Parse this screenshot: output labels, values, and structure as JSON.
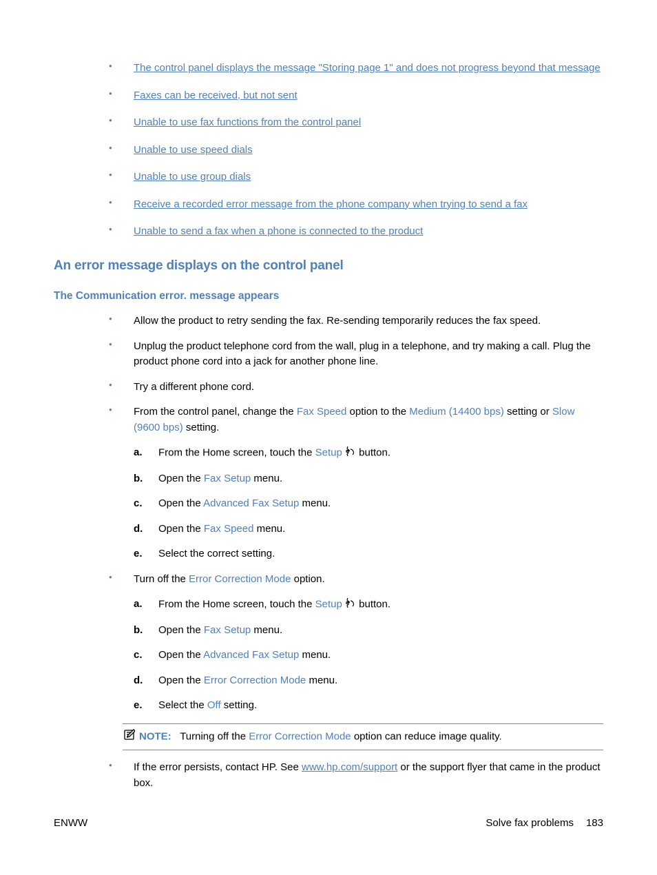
{
  "links": [
    "The control panel displays the message \"Storing page 1\" and does not progress beyond that message",
    "Faxes can be received, but not sent",
    "Unable to use fax functions from the control panel",
    "Unable to use speed dials",
    "Unable to use group dials",
    "Receive a recorded error message from the phone company when trying to send a fax",
    "Unable to send a fax when a phone is connected to the product"
  ],
  "h2": "An error message displays on the control panel",
  "h3": "The Communication error. message appears",
  "body": {
    "b0": "Allow the product to retry sending the fax. Re-sending temporarily reduces the fax speed.",
    "b1": "Unplug the product telephone cord from the wall, plug in a telephone, and try making a call. Plug the product phone cord into a jack for another phone line.",
    "b2": "Try a different phone cord.",
    "b3_pre": "From the control panel, change the ",
    "b3_t1": "Fax Speed",
    "b3_mid1": " option to the ",
    "b3_t2": "Medium (14400 bps)",
    "b3_mid2": " setting or ",
    "b3_t3": "Slow (9600 bps)",
    "b3_post": " setting.",
    "steps1": {
      "a_pre": "From the Home screen, touch the ",
      "a_term": "Setup",
      "a_post": " button.",
      "b_pre": "Open the ",
      "b_term": "Fax Setup",
      "b_post": " menu.",
      "c_pre": "Open the ",
      "c_term": "Advanced Fax Setup",
      "c_post": " menu.",
      "d_pre": "Open the ",
      "d_term": "Fax Speed",
      "d_post": " menu.",
      "e": "Select the correct setting."
    },
    "b4_pre": "Turn off the ",
    "b4_t1": "Error Correction Mode",
    "b4_post": " option.",
    "steps2": {
      "a_pre": "From the Home screen, touch the ",
      "a_term": "Setup",
      "a_post": " button.",
      "b_pre": "Open the ",
      "b_term": "Fax Setup",
      "b_post": " menu.",
      "c_pre": "Open the ",
      "c_term": "Advanced Fax Setup",
      "c_post": " menu.",
      "d_pre": "Open the ",
      "d_term": "Error Correction Mode",
      "d_post": " menu.",
      "e_pre": "Select the ",
      "e_term": "Off",
      "e_post": " setting."
    },
    "note_label": "NOTE:",
    "note_pre": "Turning off the ",
    "note_term": "Error Correction Mode",
    "note_post": " option can reduce image quality.",
    "b5_pre": "If the error persists, contact HP. See ",
    "b5_link": "www.hp.com/support",
    "b5_post": " or the support flyer that came in the product box."
  },
  "footer": {
    "left": "ENWW",
    "right": "Solve fax problems",
    "page": "183"
  },
  "markers": {
    "a": "a.",
    "b": "b.",
    "c": "c.",
    "d": "d.",
    "e": "e."
  }
}
